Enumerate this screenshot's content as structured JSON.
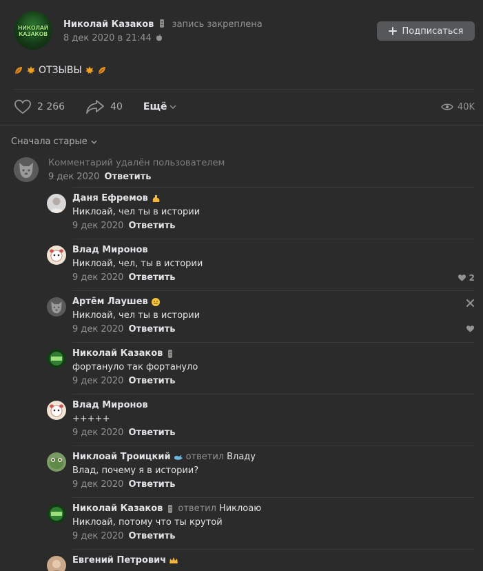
{
  "post": {
    "author": "Николай Казаков",
    "pinned_note": "запись закреплена",
    "date": "8 дек 2020 в 21:44",
    "avatar_text": "НИКОЛАЙ\nКАЗАКОВ",
    "subscribe_label": "Подписаться",
    "text": "ОТЗЫВЫ",
    "likes": "2 266",
    "shares": "40",
    "more_label": "Ещё",
    "views": "40K"
  },
  "sort": {
    "label": "Сначала старые"
  },
  "root_comment": {
    "text": "Комментарий удалён пользователем",
    "date": "9 дек 2020",
    "reply": "Ответить"
  },
  "replies": [
    {
      "name": "Даня Ефремов",
      "emoji": "muscle",
      "text": "Никлоай, чел ты в истории",
      "date": "9 дек 2020",
      "reply": "Ответить",
      "avatar_color": "#cfcfcf"
    },
    {
      "name": "Влад Миронов",
      "text": "Никлоай, чел, ты в истории",
      "date": "9 дек 2020",
      "reply": "Ответить",
      "likes": "2",
      "avatar_color": "#e8d9c8"
    },
    {
      "name": "Артём Лаушев",
      "emoji": "face",
      "text": "Никлоай, чел ты в истории",
      "date": "9 дек 2020",
      "reply": "Ответить",
      "avatar_color": "#555"
    },
    {
      "name": "Николай Казаков",
      "emoji": "moai",
      "text": "фортануло так фортануло",
      "date": "9 дек 2020",
      "reply": "Ответить",
      "avatar_color": "#1f4d20"
    },
    {
      "name": "Влад Миронов",
      "text": "+++++",
      "date": "9 дек 2020",
      "reply": "Ответить",
      "avatar_color": "#e8d9c8"
    },
    {
      "name": "Никлоай Троицкий",
      "emoji": "whale",
      "answered": "ответил",
      "to": "Владу",
      "text": "Влад, почему я в истории?",
      "date": "9 дек 2020",
      "reply": "Ответить",
      "avatar_color": "#6f8f5a"
    },
    {
      "name": "Николай Казаков",
      "emoji": "moai",
      "answered": "ответил",
      "to": "Никлоаю",
      "text": "Никлоай, потому что ты крутой",
      "date": "9 дек 2020",
      "reply": "Ответить",
      "avatar_color": "#1f4d20"
    },
    {
      "name": "Евгений Петрович",
      "emoji": "crown",
      "avatar_color": "#c9a98a"
    }
  ],
  "colors": {
    "background": "#2b2b2b",
    "text_primary": "#e1e3e6",
    "text_secondary": "#939393",
    "button_bg": "#555759"
  }
}
